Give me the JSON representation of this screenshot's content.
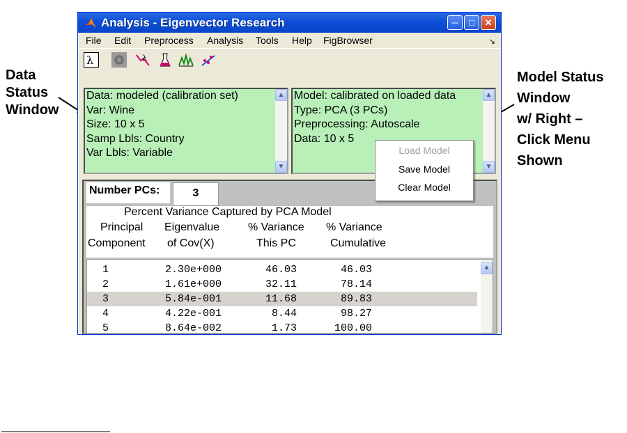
{
  "annotations": {
    "left": [
      "Data",
      "Status",
      "Window"
    ],
    "right": [
      "Model Status",
      "Window",
      "w/ Right –",
      "Click Menu",
      "Shown"
    ]
  },
  "window": {
    "title": "Analysis - Eigenvector Research",
    "controls": {
      "minimize": "minimize-icon",
      "maximize": "maximize-icon",
      "close": "close-icon"
    }
  },
  "menu": [
    "File",
    "Edit",
    "Preprocess",
    "Analysis",
    "Tools",
    "Help",
    "FigBrowser"
  ],
  "toolbar_icons": [
    "lambda-icon",
    "gear-icon",
    "preprocess-icon",
    "flask-icon",
    "peaks-icon",
    "scatter-icon"
  ],
  "data_status": {
    "lines": [
      "Data: modeled (calibration set)",
      "Var: Wine",
      "Size: 10 x 5",
      "Samp Lbls: Country",
      "Var Lbls: Variable"
    ]
  },
  "model_status": {
    "lines": [
      "Model: calibrated on loaded data",
      "Type: PCA (3 PCs)",
      "Preprocessing: Autoscale",
      "Data: 10 x 5"
    ]
  },
  "context_menu": {
    "items": [
      {
        "label": "Load Model",
        "enabled": false
      },
      {
        "label": "Save Model",
        "enabled": true
      },
      {
        "label": "Clear Model",
        "enabled": true
      }
    ]
  },
  "pcs": {
    "label": "Number PCs:",
    "value": "3"
  },
  "variance": {
    "title": "Percent Variance Captured by PCA Model",
    "headers": [
      [
        "Principal",
        "Component"
      ],
      [
        "Eigenvalue",
        "of Cov(X)"
      ],
      [
        "% Variance",
        "This  PC"
      ],
      [
        "% Variance",
        "Cumulative"
      ]
    ],
    "rows": [
      [
        "1",
        "2.30e+000",
        "46.03",
        "46.03"
      ],
      [
        "2",
        "1.61e+000",
        "32.11",
        "78.14"
      ],
      [
        "3",
        "5.84e-001",
        "11.68",
        "89.83"
      ],
      [
        "4",
        "4.22e-001",
        "8.44",
        "98.27"
      ],
      [
        "5",
        "8.64e-002",
        "1.73",
        "100.00"
      ]
    ],
    "selected_row": 3
  },
  "colors": {
    "status_panel": "#b8f0b8",
    "titlebar": "#0d4fd8",
    "selection": "#d6d3ce"
  }
}
